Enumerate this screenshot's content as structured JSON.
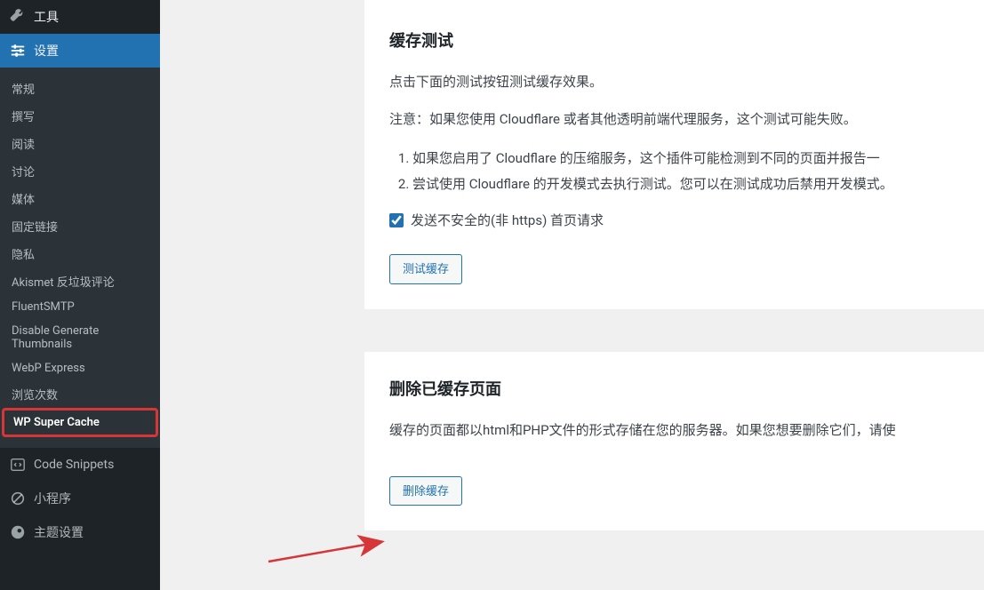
{
  "sidebar": {
    "tools": {
      "label": "工具"
    },
    "settings": {
      "label": "设置"
    },
    "submenu": [
      {
        "label": "常规"
      },
      {
        "label": "撰写"
      },
      {
        "label": "阅读"
      },
      {
        "label": "讨论"
      },
      {
        "label": "媒体"
      },
      {
        "label": "固定链接"
      },
      {
        "label": "隐私"
      },
      {
        "label": "Akismet 反垃圾评论"
      },
      {
        "label": "FluentSMTP"
      },
      {
        "label": "Disable Generate Thumbnails"
      },
      {
        "label": "WebP Express"
      },
      {
        "label": "浏览次数"
      },
      {
        "label": "WP Super Cache",
        "highlighted": true
      }
    ],
    "extras": [
      {
        "label": "Code Snippets"
      },
      {
        "label": "小程序"
      },
      {
        "label": "主题设置"
      }
    ]
  },
  "panel1": {
    "title": "缓存测试",
    "intro": "点击下面的测试按钮测试缓存效果。",
    "note": "注意：如果您使用 Cloudflare 或者其他透明前端代理服务，这个测试可能失败。",
    "li1": "如果您启用了 Cloudflare 的压缩服务，这个插件可能检测到不同的页面并报告一",
    "li2": "尝试使用 Cloudflare 的开发模式去执行测试。您可以在测试成功后禁用开发模式。",
    "checkbox_label": "发送不安全的(非 https) 首页请求",
    "button": "测试缓存"
  },
  "panel2": {
    "title": "删除已缓存页面",
    "intro": "缓存的页面都以html和PHP文件的形式存储在您的服务器。如果您想要删除它们，请使",
    "button": "删除缓存"
  }
}
